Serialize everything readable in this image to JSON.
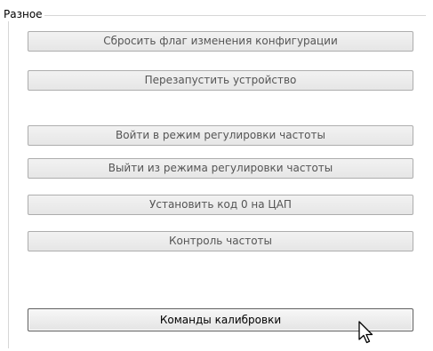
{
  "group": {
    "title": "Разное"
  },
  "buttons": [
    {
      "label": "Сбросить флаг изменения конфигурации"
    },
    {
      "label": "Перезапустить устройство"
    },
    {
      "label": "Войти в режим регулировки частоты"
    },
    {
      "label": "Выйти из режима регулировки частоты"
    },
    {
      "label": "Установить код 0 на ЦАП"
    },
    {
      "label": "Контроль частоты"
    },
    {
      "label": "Команды калибровки"
    }
  ],
  "cursor": {
    "icon": "mouse-pointer-icon"
  }
}
